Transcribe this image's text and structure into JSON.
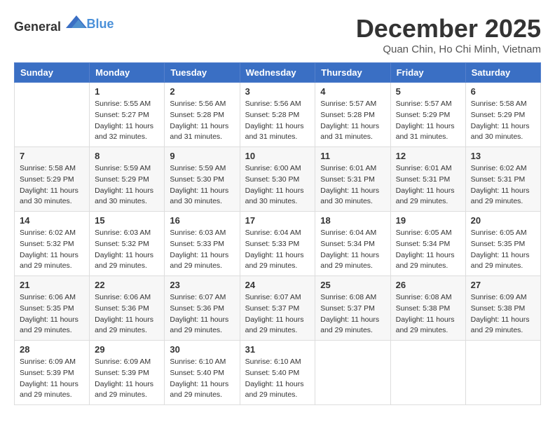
{
  "header": {
    "logo_general": "General",
    "logo_blue": "Blue",
    "month": "December 2025",
    "location": "Quan Chin, Ho Chi Minh, Vietnam"
  },
  "days_of_week": [
    "Sunday",
    "Monday",
    "Tuesday",
    "Wednesday",
    "Thursday",
    "Friday",
    "Saturday"
  ],
  "weeks": [
    [
      {
        "num": "",
        "sunrise": "",
        "sunset": "",
        "daylight": ""
      },
      {
        "num": "1",
        "sunrise": "Sunrise: 5:55 AM",
        "sunset": "Sunset: 5:27 PM",
        "daylight": "Daylight: 11 hours and 32 minutes."
      },
      {
        "num": "2",
        "sunrise": "Sunrise: 5:56 AM",
        "sunset": "Sunset: 5:28 PM",
        "daylight": "Daylight: 11 hours and 31 minutes."
      },
      {
        "num": "3",
        "sunrise": "Sunrise: 5:56 AM",
        "sunset": "Sunset: 5:28 PM",
        "daylight": "Daylight: 11 hours and 31 minutes."
      },
      {
        "num": "4",
        "sunrise": "Sunrise: 5:57 AM",
        "sunset": "Sunset: 5:28 PM",
        "daylight": "Daylight: 11 hours and 31 minutes."
      },
      {
        "num": "5",
        "sunrise": "Sunrise: 5:57 AM",
        "sunset": "Sunset: 5:29 PM",
        "daylight": "Daylight: 11 hours and 31 minutes."
      },
      {
        "num": "6",
        "sunrise": "Sunrise: 5:58 AM",
        "sunset": "Sunset: 5:29 PM",
        "daylight": "Daylight: 11 hours and 30 minutes."
      }
    ],
    [
      {
        "num": "7",
        "sunrise": "Sunrise: 5:58 AM",
        "sunset": "Sunset: 5:29 PM",
        "daylight": "Daylight: 11 hours and 30 minutes."
      },
      {
        "num": "8",
        "sunrise": "Sunrise: 5:59 AM",
        "sunset": "Sunset: 5:29 PM",
        "daylight": "Daylight: 11 hours and 30 minutes."
      },
      {
        "num": "9",
        "sunrise": "Sunrise: 5:59 AM",
        "sunset": "Sunset: 5:30 PM",
        "daylight": "Daylight: 11 hours and 30 minutes."
      },
      {
        "num": "10",
        "sunrise": "Sunrise: 6:00 AM",
        "sunset": "Sunset: 5:30 PM",
        "daylight": "Daylight: 11 hours and 30 minutes."
      },
      {
        "num": "11",
        "sunrise": "Sunrise: 6:01 AM",
        "sunset": "Sunset: 5:31 PM",
        "daylight": "Daylight: 11 hours and 30 minutes."
      },
      {
        "num": "12",
        "sunrise": "Sunrise: 6:01 AM",
        "sunset": "Sunset: 5:31 PM",
        "daylight": "Daylight: 11 hours and 29 minutes."
      },
      {
        "num": "13",
        "sunrise": "Sunrise: 6:02 AM",
        "sunset": "Sunset: 5:31 PM",
        "daylight": "Daylight: 11 hours and 29 minutes."
      }
    ],
    [
      {
        "num": "14",
        "sunrise": "Sunrise: 6:02 AM",
        "sunset": "Sunset: 5:32 PM",
        "daylight": "Daylight: 11 hours and 29 minutes."
      },
      {
        "num": "15",
        "sunrise": "Sunrise: 6:03 AM",
        "sunset": "Sunset: 5:32 PM",
        "daylight": "Daylight: 11 hours and 29 minutes."
      },
      {
        "num": "16",
        "sunrise": "Sunrise: 6:03 AM",
        "sunset": "Sunset: 5:33 PM",
        "daylight": "Daylight: 11 hours and 29 minutes."
      },
      {
        "num": "17",
        "sunrise": "Sunrise: 6:04 AM",
        "sunset": "Sunset: 5:33 PM",
        "daylight": "Daylight: 11 hours and 29 minutes."
      },
      {
        "num": "18",
        "sunrise": "Sunrise: 6:04 AM",
        "sunset": "Sunset: 5:34 PM",
        "daylight": "Daylight: 11 hours and 29 minutes."
      },
      {
        "num": "19",
        "sunrise": "Sunrise: 6:05 AM",
        "sunset": "Sunset: 5:34 PM",
        "daylight": "Daylight: 11 hours and 29 minutes."
      },
      {
        "num": "20",
        "sunrise": "Sunrise: 6:05 AM",
        "sunset": "Sunset: 5:35 PM",
        "daylight": "Daylight: 11 hours and 29 minutes."
      }
    ],
    [
      {
        "num": "21",
        "sunrise": "Sunrise: 6:06 AM",
        "sunset": "Sunset: 5:35 PM",
        "daylight": "Daylight: 11 hours and 29 minutes."
      },
      {
        "num": "22",
        "sunrise": "Sunrise: 6:06 AM",
        "sunset": "Sunset: 5:36 PM",
        "daylight": "Daylight: 11 hours and 29 minutes."
      },
      {
        "num": "23",
        "sunrise": "Sunrise: 6:07 AM",
        "sunset": "Sunset: 5:36 PM",
        "daylight": "Daylight: 11 hours and 29 minutes."
      },
      {
        "num": "24",
        "sunrise": "Sunrise: 6:07 AM",
        "sunset": "Sunset: 5:37 PM",
        "daylight": "Daylight: 11 hours and 29 minutes."
      },
      {
        "num": "25",
        "sunrise": "Sunrise: 6:08 AM",
        "sunset": "Sunset: 5:37 PM",
        "daylight": "Daylight: 11 hours and 29 minutes."
      },
      {
        "num": "26",
        "sunrise": "Sunrise: 6:08 AM",
        "sunset": "Sunset: 5:38 PM",
        "daylight": "Daylight: 11 hours and 29 minutes."
      },
      {
        "num": "27",
        "sunrise": "Sunrise: 6:09 AM",
        "sunset": "Sunset: 5:38 PM",
        "daylight": "Daylight: 11 hours and 29 minutes."
      }
    ],
    [
      {
        "num": "28",
        "sunrise": "Sunrise: 6:09 AM",
        "sunset": "Sunset: 5:39 PM",
        "daylight": "Daylight: 11 hours and 29 minutes."
      },
      {
        "num": "29",
        "sunrise": "Sunrise: 6:09 AM",
        "sunset": "Sunset: 5:39 PM",
        "daylight": "Daylight: 11 hours and 29 minutes."
      },
      {
        "num": "30",
        "sunrise": "Sunrise: 6:10 AM",
        "sunset": "Sunset: 5:40 PM",
        "daylight": "Daylight: 11 hours and 29 minutes."
      },
      {
        "num": "31",
        "sunrise": "Sunrise: 6:10 AM",
        "sunset": "Sunset: 5:40 PM",
        "daylight": "Daylight: 11 hours and 29 minutes."
      },
      {
        "num": "",
        "sunrise": "",
        "sunset": "",
        "daylight": ""
      },
      {
        "num": "",
        "sunrise": "",
        "sunset": "",
        "daylight": ""
      },
      {
        "num": "",
        "sunrise": "",
        "sunset": "",
        "daylight": ""
      }
    ]
  ]
}
